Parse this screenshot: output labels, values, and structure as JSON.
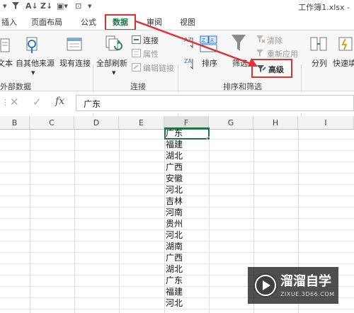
{
  "window": {
    "title": "工作簿1.xlsx -"
  },
  "tabs": [
    {
      "label": "插入",
      "active": false
    },
    {
      "label": "页面布局",
      "active": false
    },
    {
      "label": "公式",
      "active": false
    },
    {
      "label": "数据",
      "active": true
    },
    {
      "label": "审阅",
      "active": false
    },
    {
      "label": "视图",
      "active": false
    }
  ],
  "ribbon": {
    "external": {
      "text_label": "文本",
      "other_sources_label": "自其他来源",
      "existing_connections_label": "现有连接",
      "group_label": "外部数据"
    },
    "connections": {
      "refresh_all_label": "全部刷新",
      "connections_label": "连接",
      "properties_label": "属性",
      "edit_links_label": "编辑链接",
      "group_label": "连接"
    },
    "sort_filter": {
      "sort_label": "排序",
      "filter_label": "筛选",
      "clear_label": "清除",
      "reapply_label": "重新应用",
      "advanced_label": "高级",
      "group_label": "排序和筛选"
    },
    "tools": {
      "text_to_columns_label": "分列",
      "flash_fill_label": "快速填"
    }
  },
  "formula_bar": {
    "fx_label": "fx",
    "value": "广东"
  },
  "grid": {
    "columns": [
      "B",
      "C",
      "D",
      "E",
      "F",
      "G",
      "H",
      "I"
    ],
    "selected_column": "F",
    "f_values": [
      "广东",
      "福建",
      "湖北",
      "广西",
      "安徽",
      "河北",
      "吉林",
      "河南",
      "贵州",
      "河北",
      "湖南",
      "广西",
      "湖北",
      "广东",
      "福建",
      "河北"
    ]
  },
  "watermark": {
    "title": "溜溜自学",
    "url": "ZIXUE.3D66.COM"
  },
  "colors": {
    "accent": "#217346",
    "highlight": "#e03030"
  }
}
